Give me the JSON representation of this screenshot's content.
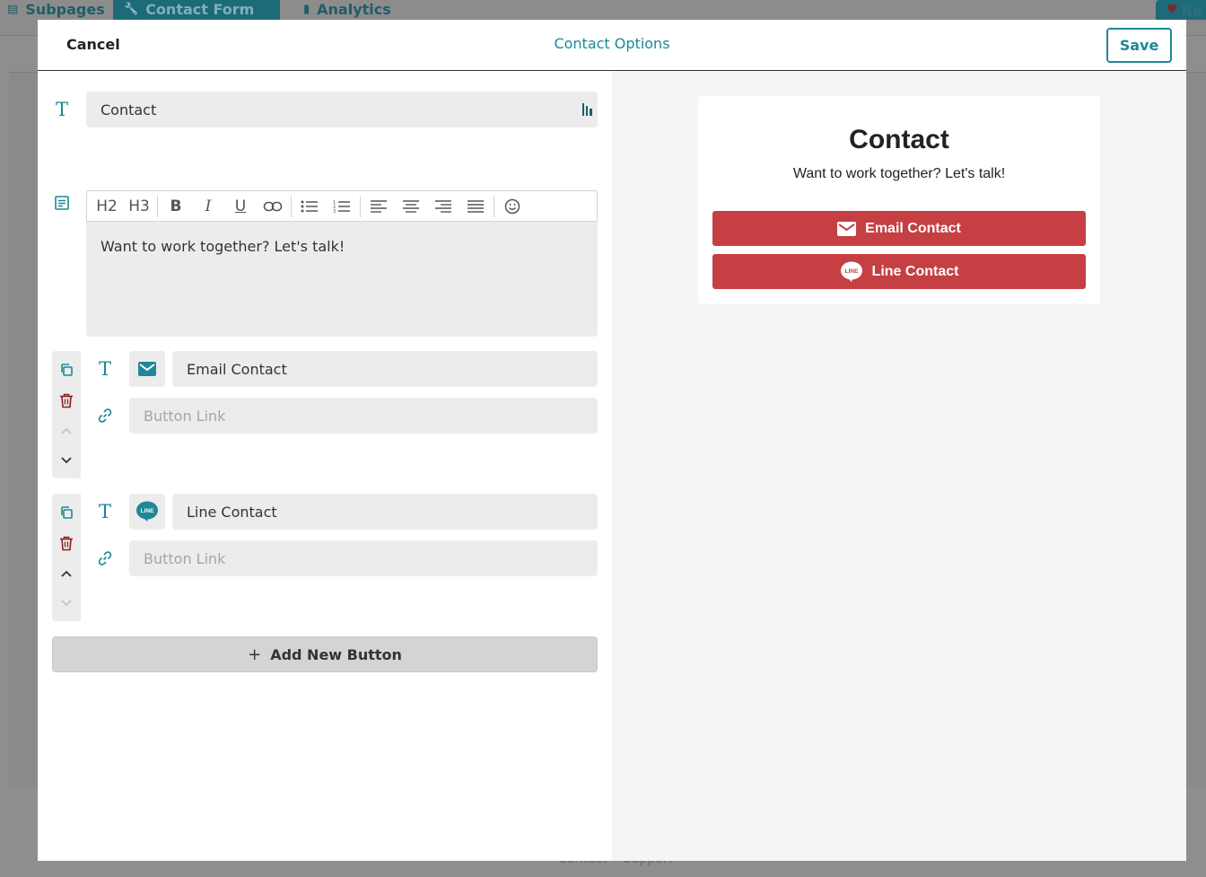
{
  "background": {
    "tabs": [
      {
        "label": "Subpages",
        "icon": "pages-icon"
      },
      {
        "label": "Contact Form",
        "icon": "wrench-icon"
      },
      {
        "label": "Analytics",
        "icon": "bar-chart-icon"
      }
    ],
    "right_button_label": "Re",
    "footer_links": [
      "Contact",
      "Support"
    ]
  },
  "modal": {
    "cancel_label": "Cancel",
    "title": "Contact Options",
    "save_label": "Save"
  },
  "editor": {
    "title_value": "Contact",
    "toolbar": {
      "h2": "H2",
      "h3": "H3",
      "bold": "B",
      "italic": "I",
      "underline": "U"
    },
    "body_text": "Want to work together? Let's talk!"
  },
  "buttons": [
    {
      "icon": "email-icon",
      "label": "Email Contact",
      "link_value": "",
      "link_placeholder": "Button Link"
    },
    {
      "icon": "line-icon",
      "label": "Line Contact",
      "link_value": "",
      "link_placeholder": "Button Link"
    }
  ],
  "add_button_label": "Add New Button",
  "preview": {
    "title": "Contact",
    "subtitle": "Want to work together? Let's talk!",
    "buttons": [
      {
        "label": "Email Contact",
        "icon": "email-icon"
      },
      {
        "label": "Line Contact",
        "icon": "line-icon"
      }
    ]
  },
  "colors": {
    "accent": "#1e8798",
    "danger": "#8b1e1e",
    "preview_button": "#c53f43",
    "overlay": "#8e8e8e"
  }
}
